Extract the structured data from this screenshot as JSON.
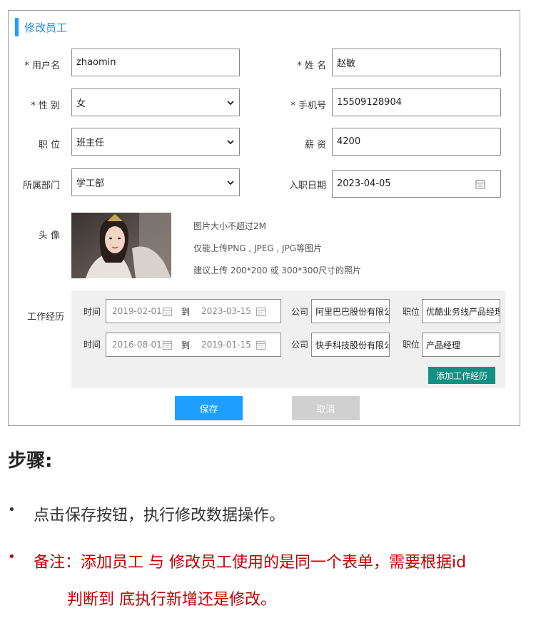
{
  "form": {
    "title": "修改员工",
    "username": {
      "label": "* 用户名",
      "value": "zhaomin"
    },
    "name": {
      "label": "* 姓  名",
      "value": "赵敏"
    },
    "gender": {
      "label": "* 性  别",
      "value": "女"
    },
    "phone": {
      "label": "* 手机号",
      "value": "15509128904"
    },
    "job": {
      "label": "职  位",
      "value": "班主任"
    },
    "salary": {
      "label": "薪  资",
      "value": "4200"
    },
    "dept": {
      "label": "所属部门",
      "value": "学工部"
    },
    "entry_date": {
      "label": "入职日期",
      "value": "2023-04-05"
    },
    "avatar": {
      "label": "头  像",
      "hints": [
        "图片大小不超过2M",
        "仅能上传PNG , JPEG , JPG等图片",
        "建议上传 200*200 或 300*300尺寸的照片"
      ]
    },
    "experience": {
      "label": "工作经历",
      "time_label": "时间",
      "to_label": "到",
      "company_label": "公司",
      "position_label": "职位",
      "rows": [
        {
          "start": "2019-02-01",
          "end": "2023-03-15",
          "company": "阿里巴巴股份有限公司",
          "position": "优酷业务线产品经理"
        },
        {
          "start": "2016-08-01",
          "end": "2019-01-15",
          "company": "快手科技股份有限公司",
          "position": "产品经理"
        }
      ],
      "add_label": "添加工作经历"
    },
    "save_label": "保存",
    "cancel_label": "取消"
  },
  "notes": {
    "title": "步骤:",
    "bullet1": "点击保存按钮，执行修改数据操作。",
    "bullet2": "备注：添加员工 与 修改员工使用的是同一个表单，需要根据id",
    "bullet2_cont": "判断到 底执行新增还是修改。"
  },
  "colors": {
    "accent": "#1e9fff",
    "add_button": "#138f83",
    "note_red": "#c00000"
  }
}
